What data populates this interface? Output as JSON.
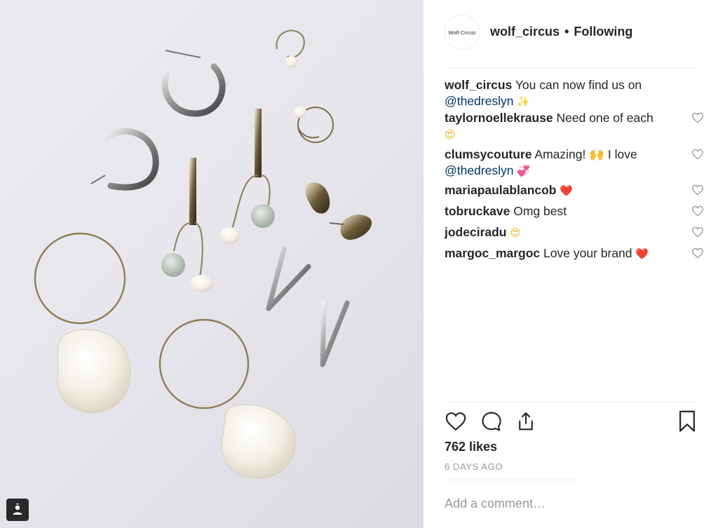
{
  "header": {
    "avatar_text": "Wolf Circus",
    "username": "wolf_circus",
    "separator": "•",
    "follow_status": "Following"
  },
  "comments": [
    {
      "user": "wolf_circus",
      "text": "You can now find us on",
      "mention": "@thedreslyn",
      "emoji": "✨",
      "emoji_color": "#e8b21d",
      "has_like": false
    },
    {
      "user": "taylornoellekrause",
      "text": "Need one of each",
      "mention": "",
      "emoji": "😍",
      "emoji_color": "#e8b21d",
      "has_like": true
    },
    {
      "user": "clumsycouture",
      "text": "Amazing! 🙌  I love",
      "mention": "@thedreslyn",
      "emoji": "💞",
      "emoji_color": "#f05b9a",
      "has_like": true
    },
    {
      "user": "mariapaulablancob",
      "text": "",
      "mention": "",
      "emoji": "❤️",
      "emoji_color": "#e0232e",
      "has_like": true
    },
    {
      "user": "tobruckave",
      "text": "Omg best",
      "mention": "",
      "emoji": "",
      "emoji_color": "",
      "has_like": true
    },
    {
      "user": "jodeciradu",
      "text": "",
      "mention": "",
      "emoji": "😍",
      "emoji_color": "#e8b21d",
      "has_like": true
    },
    {
      "user": "margoc_margoc",
      "text": "Love your brand",
      "mention": "",
      "emoji": "❤️",
      "emoji_color": "#e0232e",
      "has_like": true
    }
  ],
  "actions": {
    "like_icon": "heart-icon",
    "comment_icon": "comment-icon",
    "share_icon": "share-icon",
    "save_icon": "bookmark-icon"
  },
  "likes": "762 likes",
  "timestamp": "6 DAYS AGO",
  "comment_input": {
    "placeholder": "Add a comment…"
  },
  "colors": {
    "text": "#262626",
    "mention": "#003569",
    "muted": "#999999"
  }
}
